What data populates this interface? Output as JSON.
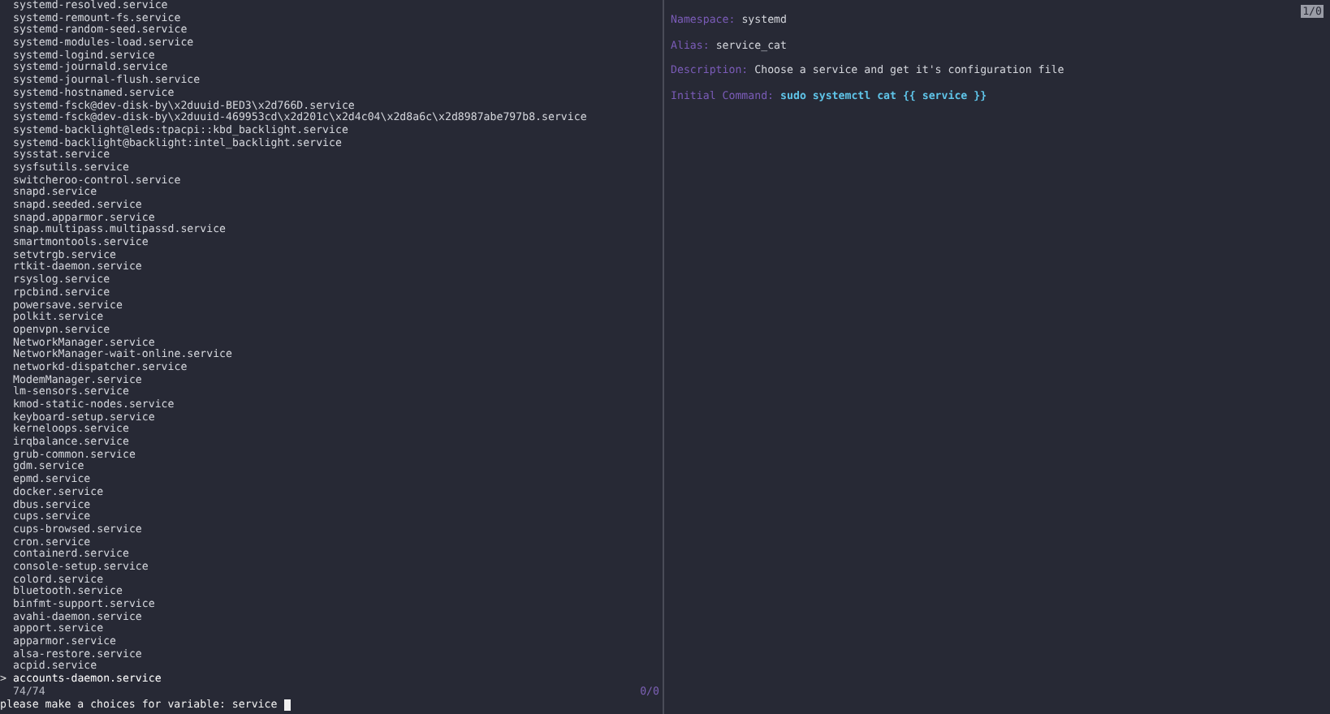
{
  "services": [
    {
      "name": "systemd-resolved.service",
      "selected": false
    },
    {
      "name": "systemd-remount-fs.service",
      "selected": false
    },
    {
      "name": "systemd-random-seed.service",
      "selected": false
    },
    {
      "name": "systemd-modules-load.service",
      "selected": false
    },
    {
      "name": "systemd-logind.service",
      "selected": false
    },
    {
      "name": "systemd-journald.service",
      "selected": false
    },
    {
      "name": "systemd-journal-flush.service",
      "selected": false
    },
    {
      "name": "systemd-hostnamed.service",
      "selected": false
    },
    {
      "name": "systemd-fsck@dev-disk-by\\x2duuid-BED3\\x2d766D.service",
      "selected": false
    },
    {
      "name": "systemd-fsck@dev-disk-by\\x2duuid-469953cd\\x2d201c\\x2d4c04\\x2d8a6c\\x2d8987abe797b8.service",
      "selected": false
    },
    {
      "name": "systemd-backlight@leds:tpacpi::kbd_backlight.service",
      "selected": false
    },
    {
      "name": "systemd-backlight@backlight:intel_backlight.service",
      "selected": false
    },
    {
      "name": "sysstat.service",
      "selected": false
    },
    {
      "name": "sysfsutils.service",
      "selected": false
    },
    {
      "name": "switcheroo-control.service",
      "selected": false
    },
    {
      "name": "snapd.service",
      "selected": false
    },
    {
      "name": "snapd.seeded.service",
      "selected": false
    },
    {
      "name": "snapd.apparmor.service",
      "selected": false
    },
    {
      "name": "snap.multipass.multipassd.service",
      "selected": false
    },
    {
      "name": "smartmontools.service",
      "selected": false
    },
    {
      "name": "setvtrgb.service",
      "selected": false
    },
    {
      "name": "rtkit-daemon.service",
      "selected": false
    },
    {
      "name": "rsyslog.service",
      "selected": false
    },
    {
      "name": "rpcbind.service",
      "selected": false
    },
    {
      "name": "powersave.service",
      "selected": false
    },
    {
      "name": "polkit.service",
      "selected": false
    },
    {
      "name": "openvpn.service",
      "selected": false
    },
    {
      "name": "NetworkManager.service",
      "selected": false
    },
    {
      "name": "NetworkManager-wait-online.service",
      "selected": false
    },
    {
      "name": "networkd-dispatcher.service",
      "selected": false
    },
    {
      "name": "ModemManager.service",
      "selected": false
    },
    {
      "name": "lm-sensors.service",
      "selected": false
    },
    {
      "name": "kmod-static-nodes.service",
      "selected": false
    },
    {
      "name": "keyboard-setup.service",
      "selected": false
    },
    {
      "name": "kerneloops.service",
      "selected": false
    },
    {
      "name": "irqbalance.service",
      "selected": false
    },
    {
      "name": "grub-common.service",
      "selected": false
    },
    {
      "name": "gdm.service",
      "selected": false
    },
    {
      "name": "epmd.service",
      "selected": false
    },
    {
      "name": "docker.service",
      "selected": false
    },
    {
      "name": "dbus.service",
      "selected": false
    },
    {
      "name": "cups.service",
      "selected": false
    },
    {
      "name": "cups-browsed.service",
      "selected": false
    },
    {
      "name": "cron.service",
      "selected": false
    },
    {
      "name": "containerd.service",
      "selected": false
    },
    {
      "name": "console-setup.service",
      "selected": false
    },
    {
      "name": "colord.service",
      "selected": false
    },
    {
      "name": "bluetooth.service",
      "selected": false
    },
    {
      "name": "binfmt-support.service",
      "selected": false
    },
    {
      "name": "avahi-daemon.service",
      "selected": false
    },
    {
      "name": "apport.service",
      "selected": false
    },
    {
      "name": "apparmor.service",
      "selected": false
    },
    {
      "name": "alsa-restore.service",
      "selected": false
    },
    {
      "name": "acpid.service",
      "selected": false
    },
    {
      "name": "accounts-daemon.service",
      "selected": true
    }
  ],
  "pointer": ">",
  "match_count": "74/74",
  "preview_count": "0/0",
  "prompt": "please make a choices for variable: service",
  "details": {
    "page": "1/0",
    "fields": [
      {
        "label": "Namespace:",
        "value": "systemd",
        "kind": "plain"
      },
      {
        "label": "Alias:",
        "value": "service_cat",
        "kind": "plain"
      },
      {
        "label": "Description:",
        "value": "Choose a service and get it's configuration file",
        "kind": "plain"
      },
      {
        "label": "Initial Command:",
        "value": "sudo systemctl cat {{ service }}",
        "kind": "command"
      }
    ]
  }
}
